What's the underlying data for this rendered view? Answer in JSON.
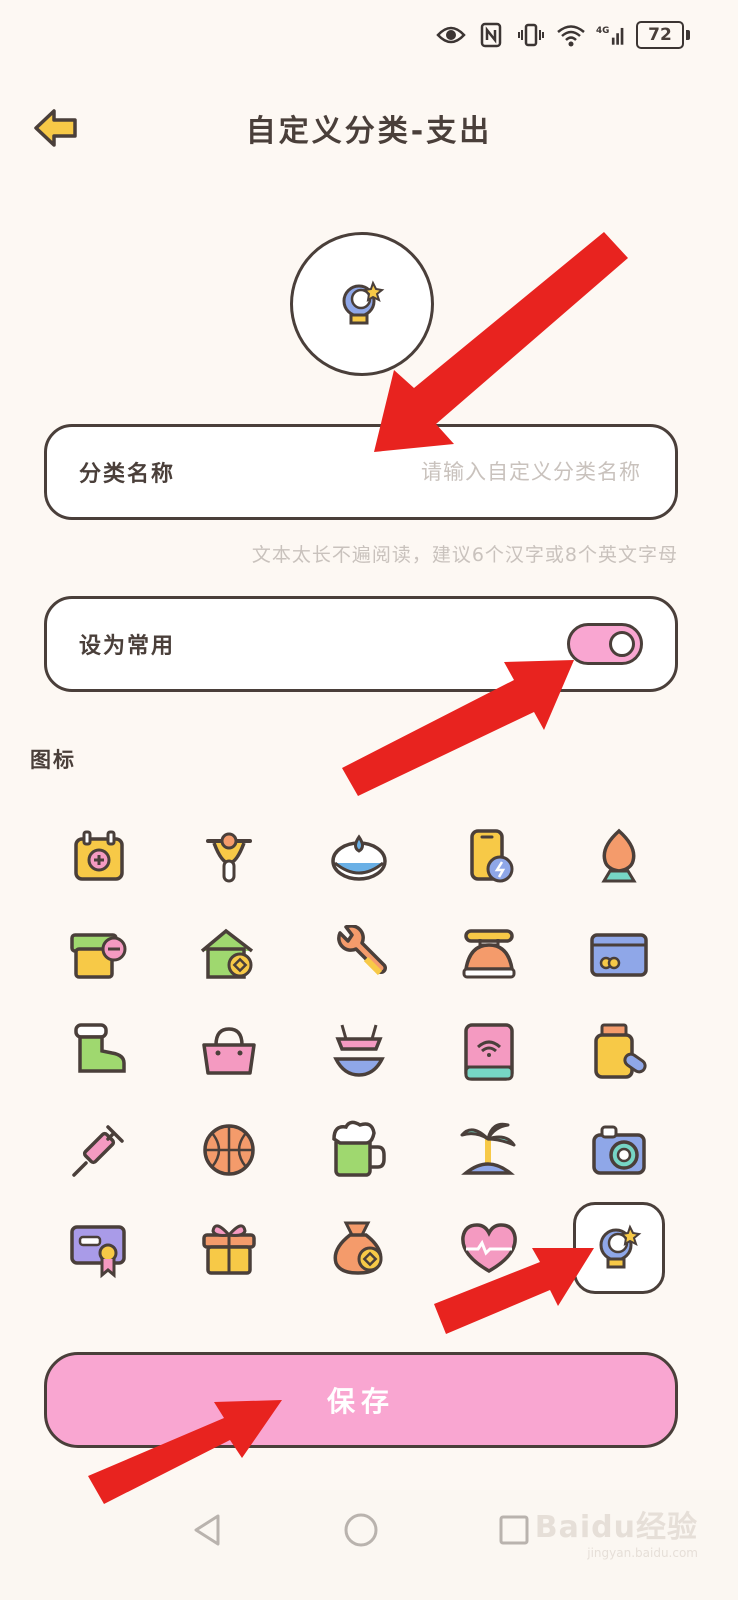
{
  "status_bar": {
    "battery": "72",
    "network": "4G"
  },
  "header": {
    "title": "自定义分类-支出"
  },
  "name_field": {
    "label": "分类名称",
    "placeholder": "请输入自定义分类名称",
    "hint": "文本太长不遍阅读，建议6个汉字或8个英文字母"
  },
  "common": {
    "label": "设为常用",
    "toggle_on": true
  },
  "icons_section": {
    "title": "图标",
    "items": [
      "calendar-plus-icon",
      "scooter-icon",
      "water-drop-bowl-icon",
      "phone-charge-icon",
      "campfire-icon",
      "box-minus-icon",
      "house-coin-icon",
      "wrench-icon",
      "rotary-phone-icon",
      "credit-card-icon",
      "boot-icon",
      "handbag-icon",
      "bikini-icon",
      "wifi-router-icon",
      "medicine-bottle-icon",
      "syringe-icon",
      "basketball-icon",
      "beer-mug-icon",
      "palm-island-icon",
      "camera-icon",
      "certificate-icon",
      "gift-box-icon",
      "money-bag-icon",
      "heart-wave-icon",
      "crystal-ball-star-icon"
    ],
    "selected_index": 24
  },
  "save_button": {
    "label": "保存"
  },
  "watermark": {
    "text": "Baidu经验",
    "sub": "jingyan.baidu.com"
  },
  "colors": {
    "accent_pink": "#f9a6d1",
    "outline": "#4a3f3a",
    "background": "#fdf8f3",
    "annotation_red": "#e8231f"
  }
}
